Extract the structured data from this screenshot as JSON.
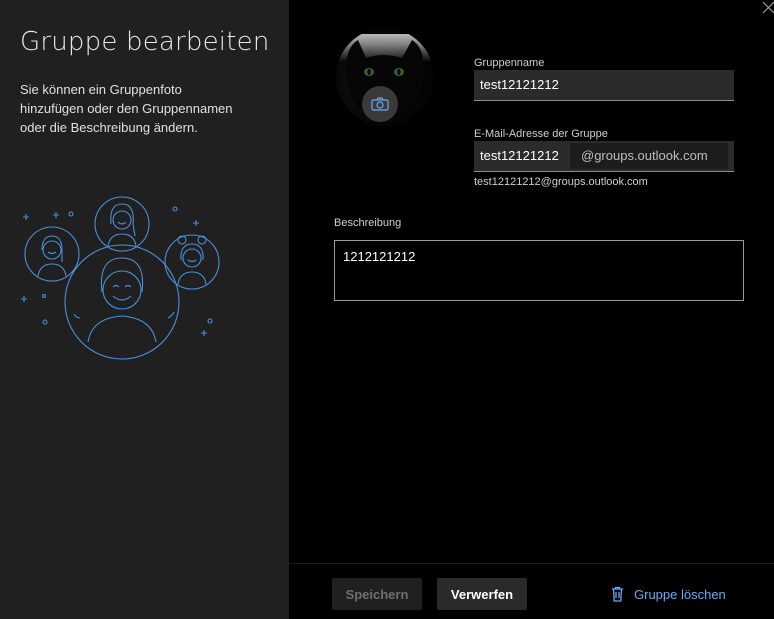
{
  "left": {
    "title": "Gruppe bearbeiten",
    "description": "Sie können ein Gruppenfoto hinzufügen oder den Gruppennamen oder die Beschreibung ändern.",
    "illustration_icon": "group-people-illustration"
  },
  "form": {
    "photo_button_icon": "camera-icon",
    "group_name_label": "Gruppenname",
    "group_name_value": "test12121212",
    "email_label": "E-Mail-Adresse der Gruppe",
    "email_user_value": "test12121212",
    "email_domain": "@groups.outlook.com",
    "email_preview": "test12121212@groups.outlook.com",
    "description_label": "Beschreibung",
    "description_value": "1212121212"
  },
  "footer": {
    "save_label": "Speichern",
    "discard_label": "Verwerfen",
    "delete_label": "Gruppe löschen",
    "delete_icon": "trash-icon"
  },
  "colors": {
    "accent": "#6ea8f0",
    "left_bg": "#202020",
    "right_bg": "#000000",
    "input_bg": "#2b2b2b"
  }
}
